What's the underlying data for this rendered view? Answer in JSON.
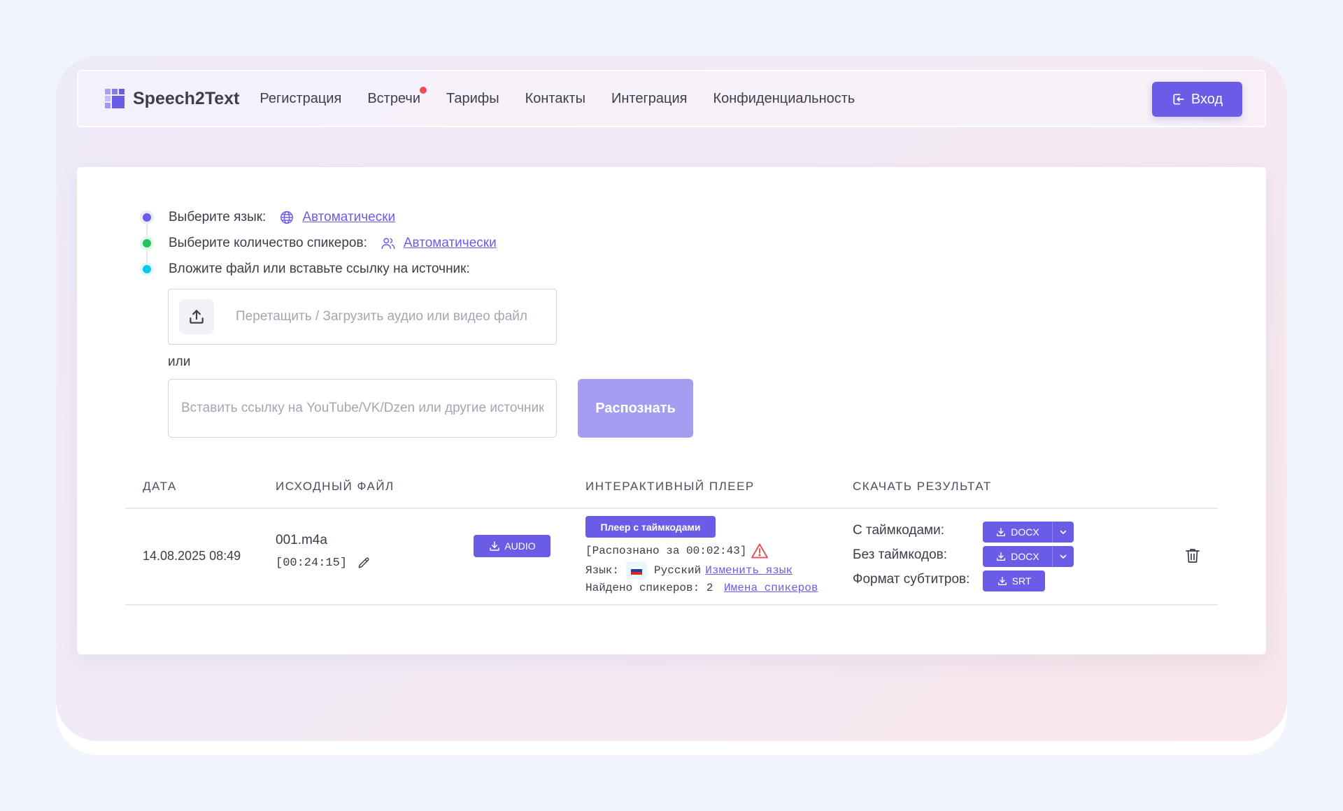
{
  "brand": {
    "name": "Speech2Text"
  },
  "nav": {
    "links": [
      "Регистрация",
      "Встречи",
      "Тарифы",
      "Контакты",
      "Интеграция",
      "Конфиденциальность"
    ],
    "login_label": "Вход"
  },
  "form": {
    "language_label": "Выберите язык:",
    "language_value": "Автоматически",
    "speakers_label": "Выберите количество спикеров:",
    "speakers_value": "Автоматически",
    "source_label": "Вложите файл или вставьте ссылку на источник:",
    "upload_placeholder": "Перетащить / Загрузить аудио или видео файл",
    "or_text": "или",
    "link_placeholder": "Вставить ссылку на YouTube/VK/Dzen или другие источники",
    "recognize_label": "Распознать"
  },
  "table": {
    "headers": [
      "ДАТА",
      "ИСХОДНЫЙ ФАЙЛ",
      "ИНТЕРАКТИВНЫЙ ПЛЕЕР",
      "СКАЧАТЬ РЕЗУЛЬТАТ"
    ],
    "row": {
      "date": "14.08.2025 08:49",
      "file_name": "001.m4a",
      "duration": "[00:24:15]",
      "audio_label": "AUDIO",
      "player_label": "Плеер с таймкодами",
      "recognized_text": "[Распознано за 00:02:43]",
      "lang_prefix": "Язык:",
      "lang_name": "Русский",
      "change_lang_link": "Изменить язык",
      "speakers_text": "Найдено спикеров: 2",
      "speaker_names_link": "Имена спикеров",
      "downloads": {
        "with_timecodes_label": "С таймкодами:",
        "without_timecodes_label": "Без таймкодов:",
        "subtitles_label": "Формат субтитров:",
        "docx_label": "DOCX",
        "srt_label": "SRT"
      }
    }
  },
  "colors": {
    "accent": "#6b5ce7",
    "step1": "#6b5ce7",
    "step2": "#22c55e",
    "step3": "#06c8e8",
    "notification": "#ef4d5a",
    "warning": "#e5484d"
  }
}
